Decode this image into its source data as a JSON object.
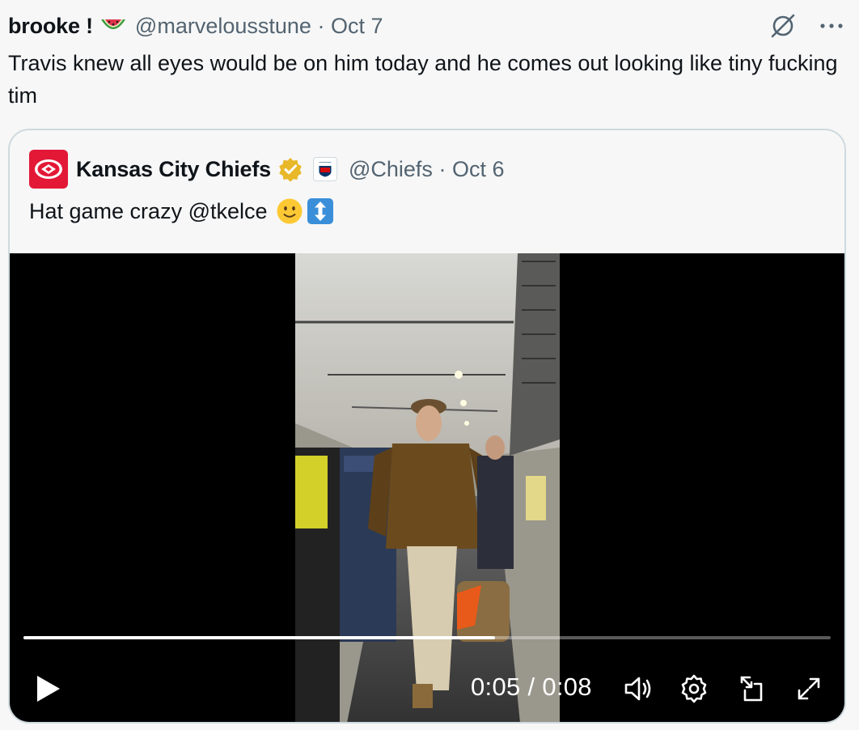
{
  "tweet": {
    "display_name": "brooke !",
    "name_emoji": "watermelon-icon",
    "handle": "@marvelousstune",
    "separator": "·",
    "date": "Oct 7",
    "text": "Travis knew all eyes would be on him today and he comes out looking like tiny fucking tim",
    "actions": [
      "grok-icon",
      "more-icon"
    ]
  },
  "quote": {
    "display_name": "Kansas City Chiefs",
    "badges": [
      "verified-icon",
      "nfl-icon"
    ],
    "handle": "@Chiefs",
    "separator": "·",
    "date": "Oct 6",
    "text": "Hat game crazy @tkelce",
    "emojis": [
      "slightly-smiling-face-icon",
      "up-down-arrow-icon"
    ]
  },
  "video": {
    "current_time": "0:05",
    "duration": "0:08",
    "time_separator": "/",
    "progress": 0.584,
    "controls": [
      "play-icon",
      "volume-icon",
      "settings-icon",
      "pip-icon",
      "fullscreen-icon"
    ]
  },
  "colors": {
    "background": "#f7f7f7",
    "secondary_text": "#536471",
    "border": "#cfd9de",
    "chiefs_red": "#e31837",
    "verified_gold": "#e8b829"
  }
}
